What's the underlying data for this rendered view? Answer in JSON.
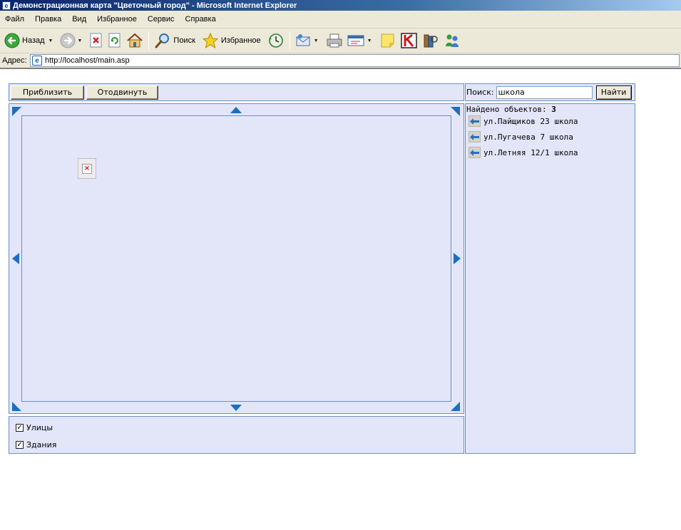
{
  "window": {
    "title": "Демонстрационная карта \"Цветочный город\" - Microsoft Internet Explorer"
  },
  "menu": {
    "items": [
      "Файл",
      "Правка",
      "Вид",
      "Избранное",
      "Сервис",
      "Справка"
    ]
  },
  "toolbar": {
    "back_label": "Назад",
    "search_label": "Поиск",
    "favorites_label": "Избранное"
  },
  "address": {
    "label": "Адрес:",
    "url": "http://localhost/main.asp"
  },
  "zoom": {
    "zoom_in_label": "Приблизить",
    "zoom_out_label": "Отодвинуть"
  },
  "layers": [
    {
      "label": "Улицы",
      "checked": true
    },
    {
      "label": "Здания",
      "checked": true
    }
  ],
  "search": {
    "label": "Поиск:",
    "value": "школа",
    "button_label": "Найти"
  },
  "results": {
    "found_label": "Найдено объектов:",
    "count": "3",
    "items": [
      {
        "label": "ул.Пайщиков 23 школа"
      },
      {
        "label": "ул.Пугачева 7 школа"
      },
      {
        "label": "ул.Летняя 12/1 школа"
      }
    ]
  },
  "colors": {
    "panel_bg": "#e3e5f9",
    "panel_border": "#6d8ec4",
    "arrow": "#1b6fc2"
  }
}
